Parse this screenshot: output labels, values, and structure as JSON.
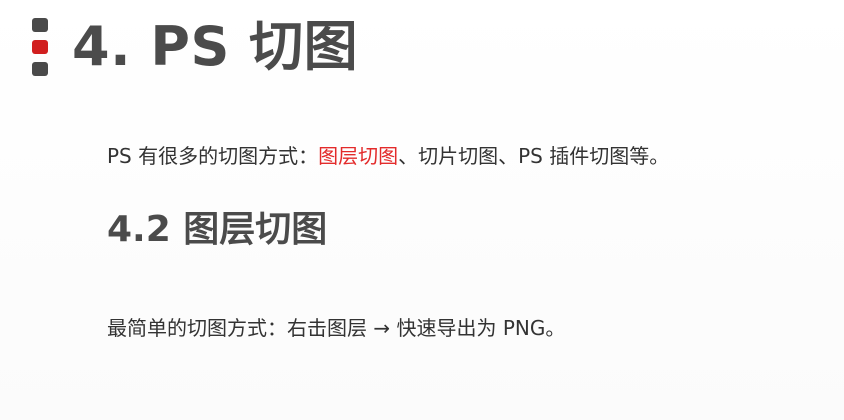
{
  "title": "4. PS 切图",
  "intro": {
    "prefix": "PS 有很多的切图方式：",
    "highlight": "图层切图",
    "suffix": "、切片切图、PS 插件切图等。"
  },
  "subheading": "4.2 图层切图",
  "instruction": "最简单的切图方式：右击图层 → 快速导出为 PNG。",
  "colors": {
    "highlight": "#e32b2b",
    "marker_accent": "#d11f1f",
    "heading": "#4b4b4b"
  }
}
